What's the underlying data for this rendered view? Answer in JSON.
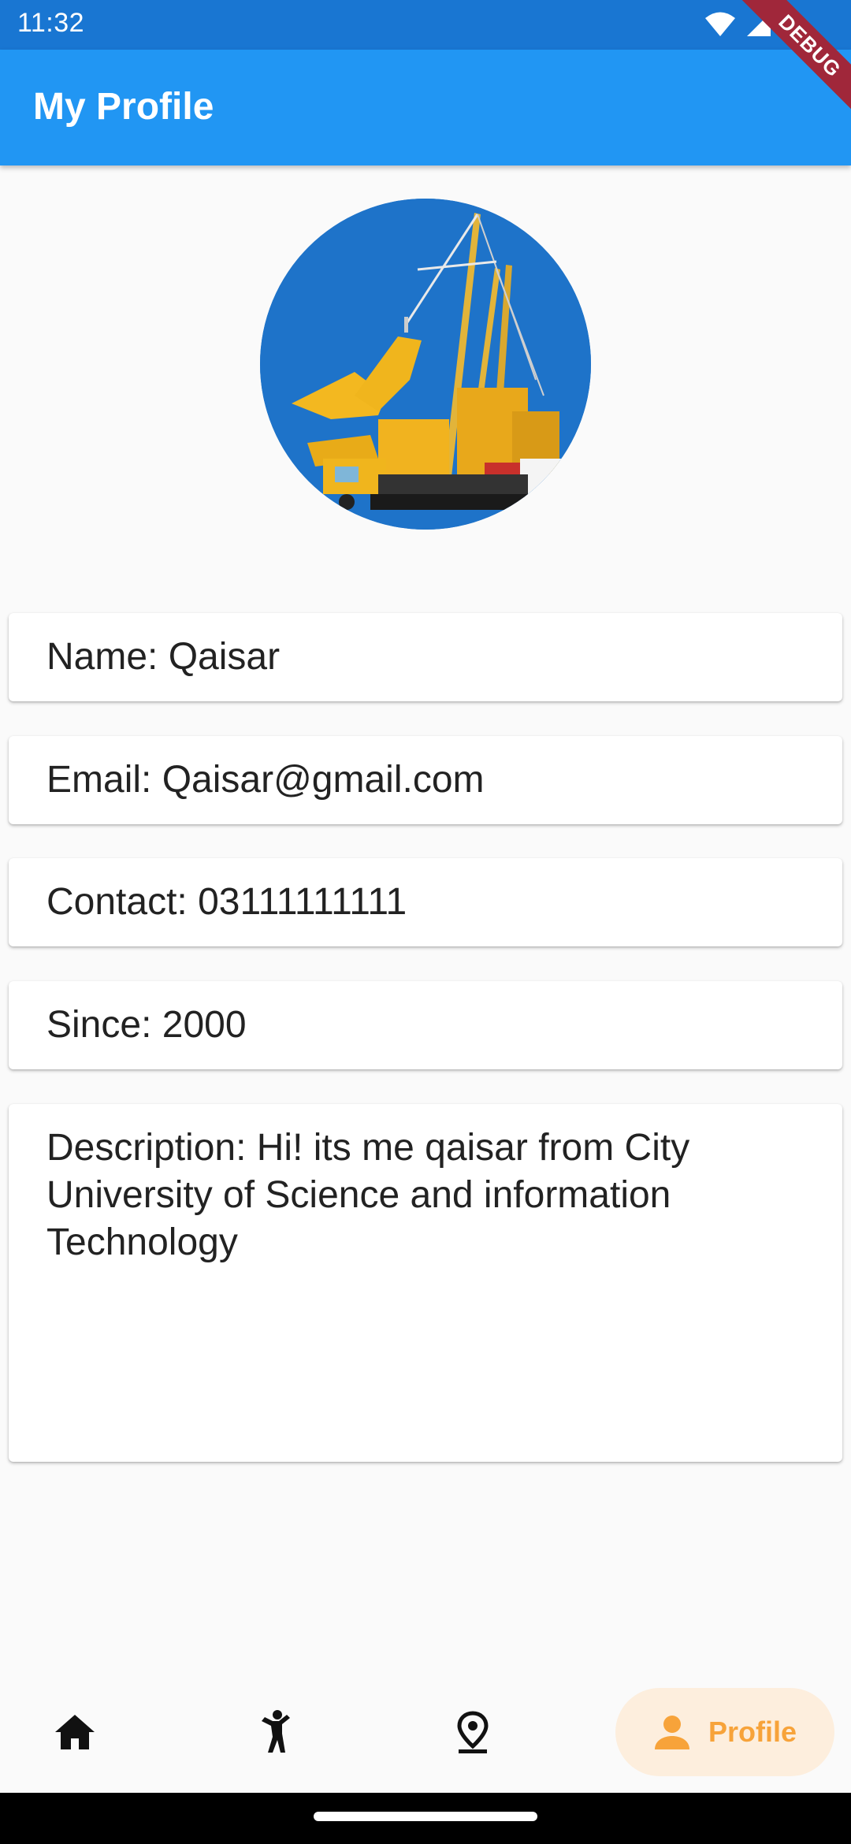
{
  "status_bar": {
    "time": "11:32"
  },
  "debug_banner": "DEBUG",
  "app_bar": {
    "title": "My Profile"
  },
  "profile": {
    "name": "Name: Qaisar",
    "email": "Email: Qaisar@gmail.com",
    "contact": "Contact: 03111111111",
    "since": "Since: 2000",
    "description": "Description:  Hi! its me qaisar from City University of Science and information Technology"
  },
  "bottom_nav": {
    "items": [
      {
        "icon": "home-icon"
      },
      {
        "icon": "person-pose-icon"
      },
      {
        "icon": "location-pin-icon"
      },
      {
        "icon": "person-icon",
        "label": "Profile"
      }
    ],
    "active_color": "#f7a33a"
  },
  "colors": {
    "app_bar": "#2196f3",
    "status_bar": "#1976d2"
  }
}
